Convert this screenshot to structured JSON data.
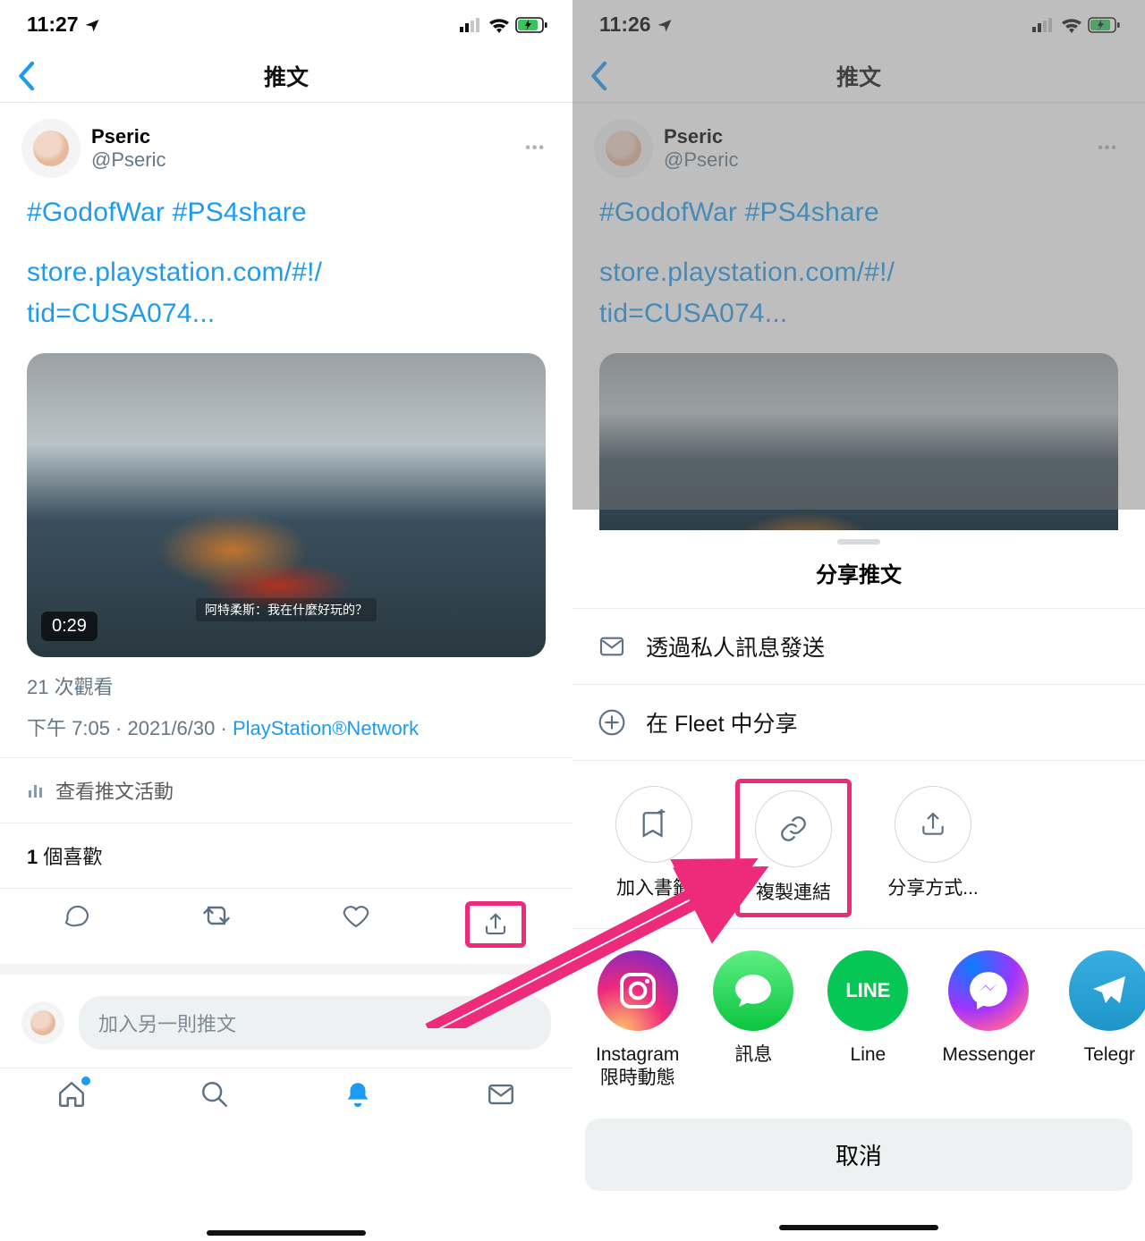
{
  "left": {
    "status": {
      "time": "11:27"
    },
    "nav": {
      "title": "推文"
    },
    "tweet": {
      "display_name": "Pseric",
      "handle": "@Pseric",
      "hashtags": "#GodofWar #PS4share",
      "link_line1": "store.playstation.com/#!/",
      "link_line2": "tid=CUSA074...",
      "video_duration": "0:29",
      "video_subtitle": "阿特柔斯：我在什麼好玩的？",
      "views": "21 次觀看",
      "meta_time": "下午 7:05",
      "meta_date": "2021/6/30",
      "meta_source": "PlayStation®Network",
      "activity": "查看推文活動",
      "likes_count": "1",
      "likes_label": " 個喜歡",
      "compose_placeholder": "加入另一則推文"
    }
  },
  "right": {
    "status": {
      "time": "11:26"
    },
    "nav": {
      "title": "推文"
    },
    "tweet": {
      "display_name": "Pseric",
      "handle": "@Pseric",
      "hashtags": "#GodofWar #PS4share",
      "link_line1": "store.playstation.com/#!/",
      "link_line2": "tid=CUSA074..."
    },
    "sheet": {
      "title": "分享推文",
      "dm": "透過私人訊息發送",
      "fleet": "在 Fleet 中分享",
      "bookmark": "加入書籤",
      "copy": "複製連結",
      "sharevia": "分享方式...",
      "apps": {
        "instagram": "Instagram\n限時動態",
        "messages": "訊息",
        "line": "Line",
        "messenger": "Messenger",
        "telegram": "Telegr"
      },
      "cancel": "取消"
    }
  }
}
